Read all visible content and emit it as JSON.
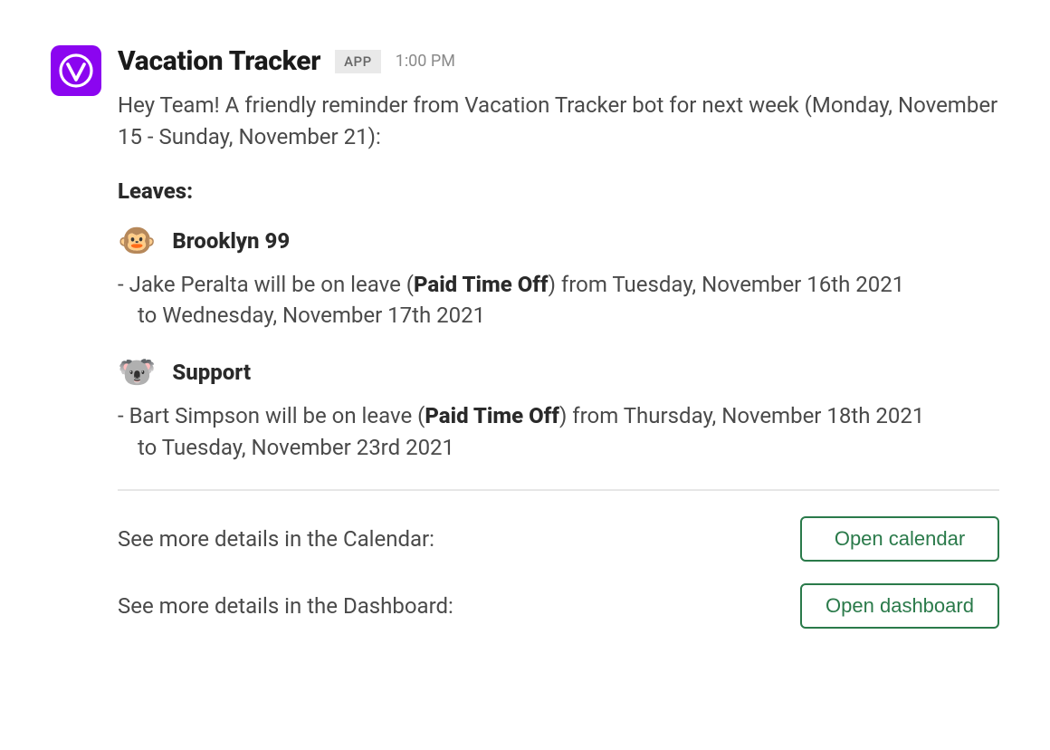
{
  "header": {
    "app_name": "Vacation Tracker",
    "app_badge": "APP",
    "timestamp": "1:00 PM"
  },
  "intro": "Hey Team! A friendly reminder from Vacation Tracker bot for next week (Monday, November 15 - Sunday, November 21):",
  "leaves_title": "Leaves:",
  "teams": [
    {
      "emoji": "🐵",
      "name": "Brooklyn 99",
      "item_prefix": "- Jake Peralta will be on leave (",
      "item_bold": "Paid Time Off",
      "item_mid": ") from Tuesday, November 16th 2021",
      "item_cont": "to Wednesday, November 17th 2021"
    },
    {
      "emoji": "🐨",
      "name": "Support",
      "item_prefix": "- Bart Simpson will be on leave (",
      "item_bold": "Paid Time Off",
      "item_mid": ") from Thursday, November 18th 2021",
      "item_cont": "to Tuesday, November 23rd 2021"
    }
  ],
  "actions": {
    "calendar_label": "See more details in the Calendar:",
    "calendar_button": "Open calendar",
    "dashboard_label": "See more details in the Dashboard:",
    "dashboard_button": "Open dashboard"
  }
}
